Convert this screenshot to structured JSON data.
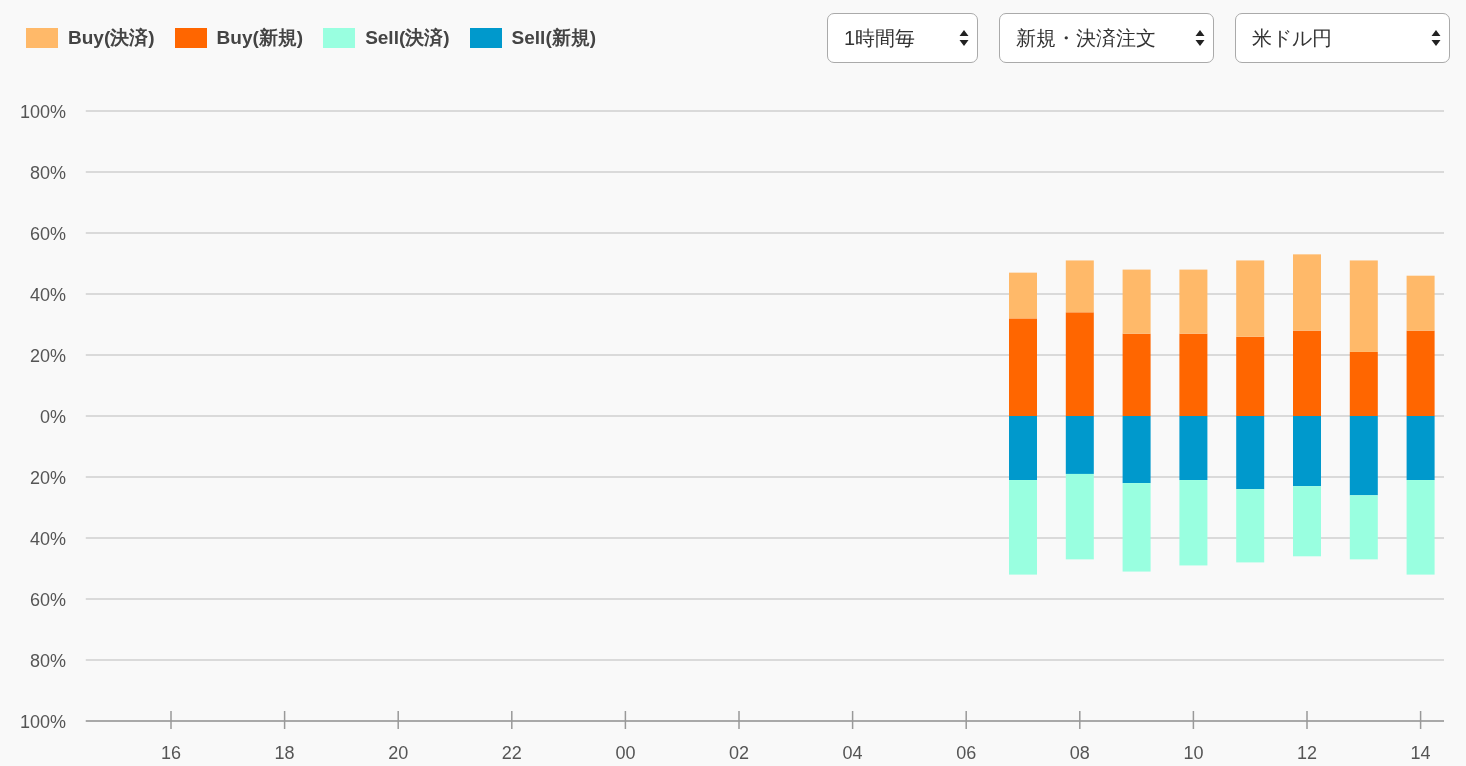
{
  "controls": [
    {
      "value": "1時間毎"
    },
    {
      "value": "新規・決済注文"
    },
    {
      "value": "米ドル円"
    }
  ],
  "chart": {
    "chart_data": {
      "type": "bar",
      "stacked": true,
      "grid": true,
      "categories": [
        null,
        "16",
        null,
        "18",
        null,
        "20",
        null,
        "22",
        null,
        "00",
        null,
        "02",
        null,
        "04",
        null,
        "06",
        null,
        "08",
        null,
        "10",
        null,
        "12",
        null,
        "14"
      ],
      "ylim": [
        -100,
        100
      ],
      "yticks": [
        {
          "value": 100,
          "label": "100%"
        },
        {
          "value": 80,
          "label": "80%"
        },
        {
          "value": 60,
          "label": "60%"
        },
        {
          "value": 40,
          "label": "40%"
        },
        {
          "value": 20,
          "label": "20%"
        },
        {
          "value": 0,
          "label": "0%"
        },
        {
          "value": -20,
          "label": "20%"
        },
        {
          "value": -40,
          "label": "40%"
        },
        {
          "value": -60,
          "label": "60%"
        },
        {
          "value": -80,
          "label": "80%"
        },
        {
          "value": -100,
          "label": "100%"
        }
      ],
      "series": [
        {
          "name": "Buy(決済)",
          "color": "#ffb969",
          "values": [
            null,
            null,
            null,
            null,
            null,
            null,
            null,
            null,
            null,
            null,
            null,
            null,
            null,
            null,
            null,
            null,
            15,
            17,
            21,
            21,
            25,
            25,
            30,
            18
          ]
        },
        {
          "name": "Buy(新規)",
          "color": "#ff6600",
          "values": [
            null,
            null,
            null,
            null,
            null,
            null,
            null,
            null,
            null,
            null,
            null,
            null,
            null,
            null,
            null,
            null,
            32,
            34,
            27,
            27,
            26,
            28,
            21,
            28
          ]
        },
        {
          "name": "Sell(決済)",
          "color": "#99ffe0",
          "values": [
            null,
            null,
            null,
            null,
            null,
            null,
            null,
            null,
            null,
            null,
            null,
            null,
            null,
            null,
            null,
            null,
            -31,
            -28,
            -29,
            -28,
            -24,
            -23,
            -21,
            -31
          ]
        },
        {
          "name": "Sell(新規)",
          "color": "#0099cc",
          "values": [
            null,
            null,
            null,
            null,
            null,
            null,
            null,
            null,
            null,
            null,
            null,
            null,
            null,
            null,
            null,
            null,
            -21,
            -19,
            -22,
            -21,
            -24,
            -23,
            -26,
            -21
          ]
        }
      ]
    }
  }
}
